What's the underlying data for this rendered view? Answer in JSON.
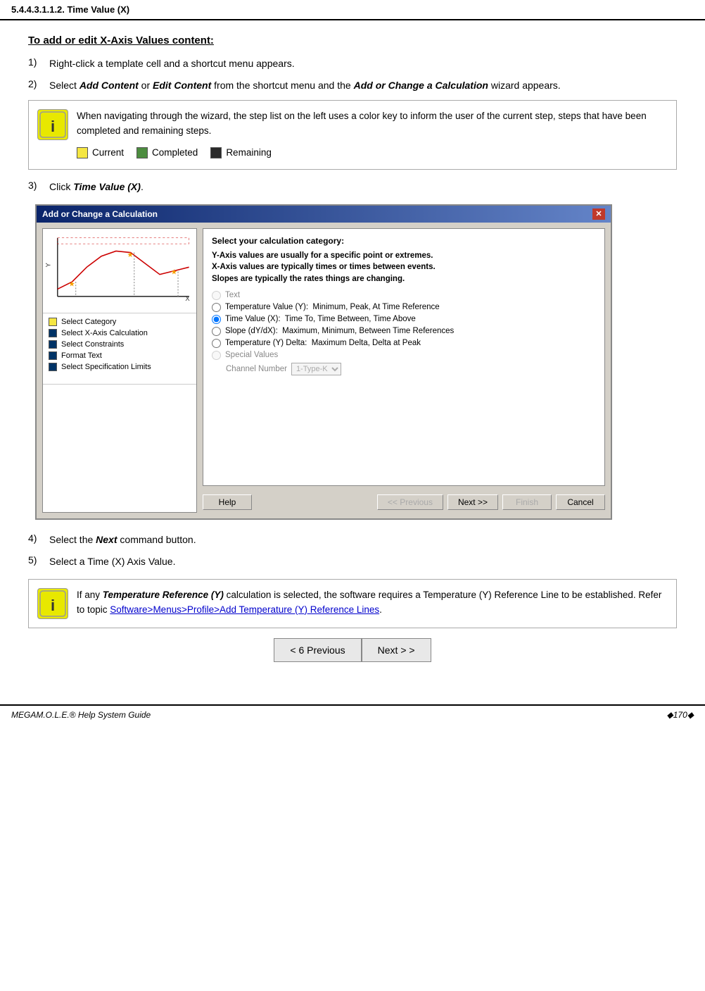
{
  "header": {
    "title": "5.4.4.3.1.1.2. Time Value (X)"
  },
  "section": {
    "title": "To add or edit X-Axis Values content:",
    "steps": [
      {
        "num": "1)",
        "text": "Right-click a template cell and a shortcut menu appears."
      },
      {
        "num": "2)",
        "text_html": "Select <b><i>Add Content</i></b> or <b><i>Edit Content</i></b> from the shortcut menu and the <b><i>Add or Change a Calculation</i></b> wizard appears."
      },
      {
        "num": "3)",
        "text_html": "Click <b><i>Time Value (X)</i></b>."
      },
      {
        "num": "4)",
        "text_html": "Select the <b><i>Next</i></b> command button."
      },
      {
        "num": "5)",
        "text": "Select a Time (X) Axis Value."
      }
    ]
  },
  "note1": {
    "text": "When navigating through the wizard, the step list on the left uses a color key to inform the user of the current step, steps that have been completed and remaining steps.",
    "color_key": [
      {
        "label": "Current",
        "color": "#f5e642"
      },
      {
        "label": "Completed",
        "color": "#4c8c3f"
      },
      {
        "label": "Remaining",
        "color": "#2a2a2a"
      }
    ]
  },
  "note2": {
    "text_prefix": "If any ",
    "bold_text": "Temperature Reference (Y)",
    "text_mid": " calculation is selected, the software requires a Temperature (Y) Reference Line to be established. Refer to topic ",
    "link_text": "Software>Menus>Profile>Add Temperature (Y) Reference Lines",
    "text_end": "."
  },
  "dialog": {
    "title": "Add or Change a Calculation",
    "close_btn": "✕",
    "left_steps": [
      {
        "label": "Select Category",
        "color": "yellow"
      },
      {
        "label": "Select X-Axis Calculation",
        "color": "darkblue"
      },
      {
        "label": "Select Constraints",
        "color": "darkblue"
      },
      {
        "label": "Format Text",
        "color": "darkblue"
      },
      {
        "label": "Select Specification Limits",
        "color": "darkblue"
      }
    ],
    "right": {
      "heading": "Select your calculation category:",
      "description": "Y-Axis values are usually for a specific point or extremes.\nX-Axis values are typically times or times between events.\nSlopes are typically the rates things are changing.",
      "options": [
        {
          "label": "Text",
          "disabled": true,
          "selected": false
        },
        {
          "label": "Temperature Value (Y):  Minimum, Peak, At Time Reference",
          "disabled": false,
          "selected": false
        },
        {
          "label": "Time Value (X):  Time To, Time Between, Time Above",
          "disabled": false,
          "selected": true
        },
        {
          "label": "Slope (dY/dX):  Maximum, Minimum, Between Time References",
          "disabled": false,
          "selected": false
        },
        {
          "label": "Temperature (Y) Delta:  Maximum Delta, Delta at Peak",
          "disabled": false,
          "selected": false
        },
        {
          "label": "Special Values",
          "disabled": true,
          "selected": false
        }
      ],
      "channel_label": "Channel Number",
      "channel_value": "1-Type-K",
      "buttons": [
        {
          "label": "Help",
          "disabled": false
        },
        {
          "label": "<< Previous",
          "disabled": true
        },
        {
          "label": "Next >>",
          "disabled": false
        },
        {
          "label": "Finish",
          "disabled": true
        },
        {
          "label": "Cancel",
          "disabled": false
        }
      ]
    }
  },
  "nav": {
    "prev_label": "< 6 Previous",
    "next_label": "Next > >"
  },
  "footer": {
    "left": "MEGAM.O.L.E.® Help System Guide",
    "right": "◆170◆"
  }
}
